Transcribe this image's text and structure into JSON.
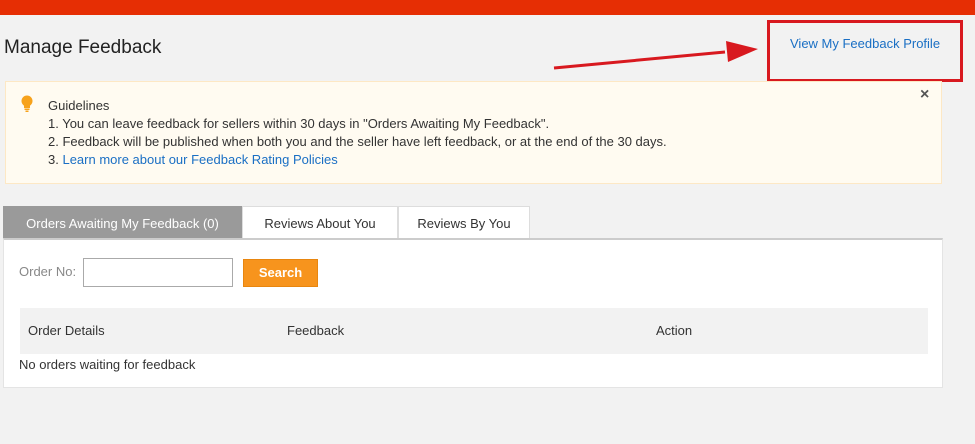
{
  "page": {
    "title": "Manage Feedback",
    "profile_link": "View My Feedback Profile"
  },
  "guidelines": {
    "title": "Guidelines",
    "line1": "1. You can leave feedback for sellers within 30 days in \"Orders Awaiting My Feedback\".",
    "line2": "2. Feedback will be published when both you and the seller have left feedback, or at the end of the 30 days.",
    "line3_prefix": "3. ",
    "line3_link": "Learn more about our Feedback Rating Policies",
    "close": "×"
  },
  "tabs": [
    {
      "label": "Orders Awaiting My Feedback (0)",
      "active": true
    },
    {
      "label": "Reviews About You",
      "active": false
    },
    {
      "label": "Reviews By You",
      "active": false
    }
  ],
  "search": {
    "label": "Order No:",
    "value": "",
    "button": "Search"
  },
  "table": {
    "columns": [
      "Order Details",
      "Feedback",
      "Action"
    ],
    "empty_message": "No orders waiting for feedback"
  },
  "colors": {
    "top_bar": "#e62e04",
    "link": "#1a6fc4",
    "search_button": "#f7941d",
    "annotation": "#d8191f",
    "active_tab": "#9a9a9a"
  },
  "icons": {
    "guidelines": "lightbulb-icon",
    "close": "close-icon"
  }
}
